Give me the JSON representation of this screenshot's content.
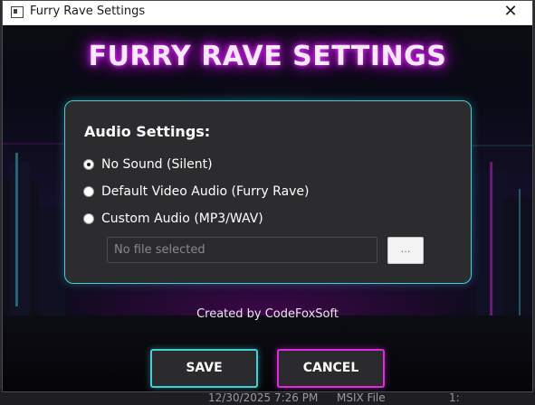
{
  "window": {
    "title": "Furry Rave Settings",
    "close_glyph": "✕"
  },
  "heading": "FURRY RAVE SETTINGS",
  "audio": {
    "title": "Audio Settings:",
    "options": [
      {
        "label": "No Sound (Silent)",
        "selected": true
      },
      {
        "label": "Default Video Audio (Furry Rave)",
        "selected": false
      },
      {
        "label": "Custom Audio (MP3/WAV)",
        "selected": false
      }
    ],
    "file_placeholder": "No file selected",
    "browse_label": "..."
  },
  "credit": "Created by CodeFoxSoft",
  "buttons": {
    "save": "SAVE",
    "cancel": "CANCEL"
  },
  "background_row": {
    "date": "12/30/2025 7:26 PM",
    "type": "MSIX File",
    "size": "1:"
  },
  "colors": {
    "cyan_accent": "#3fd0d8",
    "magenta_accent": "#e02ae0",
    "panel": "#2c2c2e"
  }
}
